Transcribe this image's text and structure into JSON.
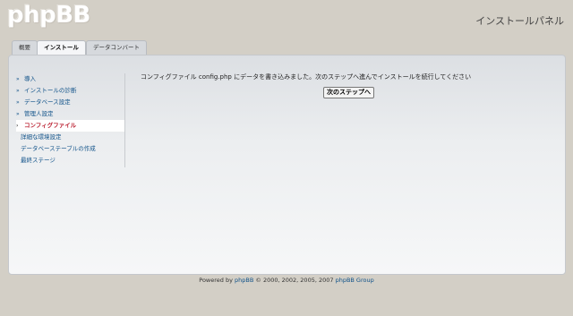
{
  "header": {
    "logo_text": "phpBB",
    "panel_title": "インストールパネル"
  },
  "tabs": [
    {
      "label": "概要",
      "active": false
    },
    {
      "label": "インストール",
      "active": true
    },
    {
      "label": "データコンバート",
      "active": false
    }
  ],
  "sidebar": {
    "items": [
      {
        "label": "導入",
        "state": "done"
      },
      {
        "label": "インストールの診断",
        "state": "done"
      },
      {
        "label": "データベース設定",
        "state": "done"
      },
      {
        "label": "管理人設定",
        "state": "done"
      },
      {
        "label": "コンフィグファイル",
        "state": "current"
      },
      {
        "label": "詳細な環境設定",
        "state": "pending"
      },
      {
        "label": "データベーステーブルの作成",
        "state": "pending"
      },
      {
        "label": "最終ステージ",
        "state": "pending"
      }
    ]
  },
  "main": {
    "message": "コンフィグファイル config.php にデータを書き込みました。次のステップへ進んでインストールを続行してください",
    "next_button": "次のステップへ"
  },
  "footer": {
    "prefix": "Powered by ",
    "software": "phpBB",
    "copyright": " © 2000, 2002, 2005, 2007 ",
    "group": "phpBB Group"
  }
}
